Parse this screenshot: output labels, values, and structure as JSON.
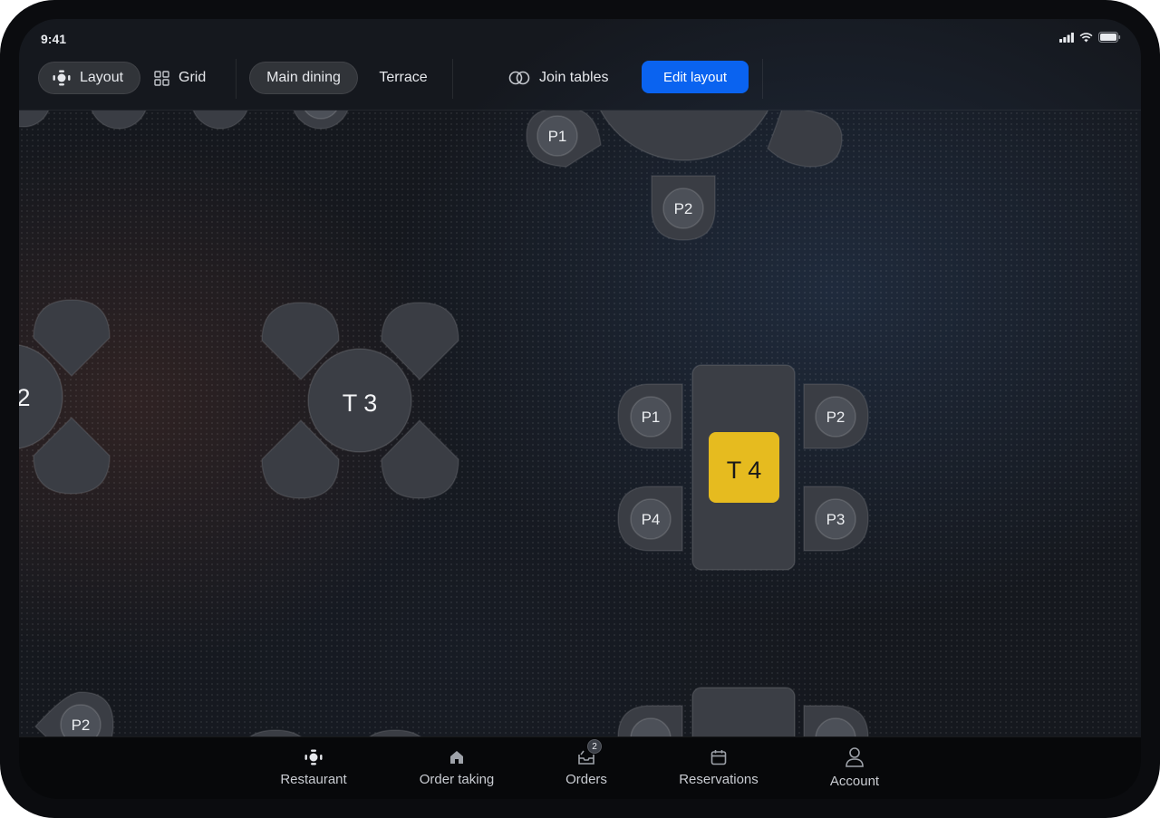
{
  "status_bar": {
    "time": "9:41"
  },
  "toolbar": {
    "view_modes": [
      {
        "label": "Layout",
        "icon": "layout-icon",
        "active": true
      },
      {
        "label": "Grid",
        "icon": "grid-icon",
        "active": false
      }
    ],
    "areas": [
      {
        "label": "Main dining",
        "active": true
      },
      {
        "label": "Terrace",
        "active": false
      }
    ],
    "join_tables_label": "Join tables",
    "edit_layout_label": "Edit layout"
  },
  "floor_plan": {
    "tables": [
      {
        "label": "2",
        "seats": []
      },
      {
        "label": "T 3",
        "seats": []
      },
      {
        "label": "T 4",
        "selected": true,
        "seats": [
          "P1",
          "P2",
          "P3",
          "P4"
        ]
      }
    ],
    "top_table_seats": [
      "P1",
      "P2"
    ],
    "bottom_left_seat": "P2"
  },
  "bottom_nav": {
    "items": [
      {
        "label": "Restaurant",
        "icon": "restaurant-icon"
      },
      {
        "label": "Order taking",
        "icon": "home-icon"
      },
      {
        "label": "Orders",
        "icon": "orders-icon",
        "badge": "2"
      },
      {
        "label": "Reservations",
        "icon": "calendar-icon"
      },
      {
        "label": "Account",
        "icon": "user-icon"
      }
    ]
  },
  "colors": {
    "accent": "#0a63f0",
    "selected_table": "#e6bb1f"
  }
}
